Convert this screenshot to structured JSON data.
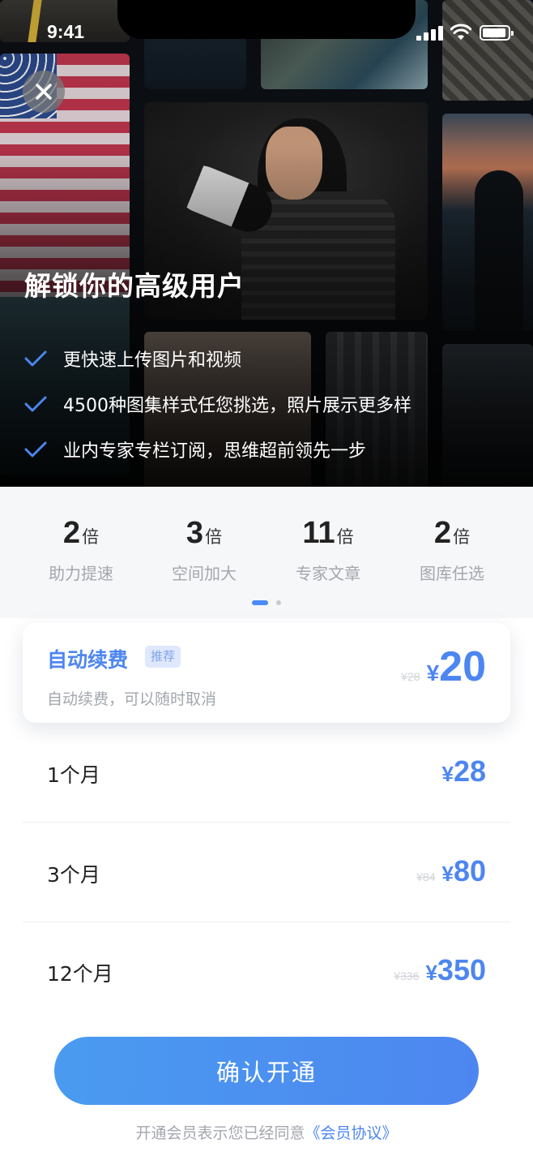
{
  "status_bar": {
    "time": "9:41"
  },
  "hero": {
    "title": "解锁你的高级用户",
    "benefits": [
      "更快速上传图片和视频",
      "4500种图集样式任您挑选，照片展示更多样",
      "业内专家专栏订阅，思维超前领先一步"
    ]
  },
  "stats": [
    {
      "value": "2",
      "unit": "倍",
      "label": "助力提速"
    },
    {
      "value": "3",
      "unit": "倍",
      "label": "空间加大"
    },
    {
      "value": "11",
      "unit": "倍",
      "label": "专家文章"
    },
    {
      "value": "2",
      "unit": "倍",
      "label": "图库任选"
    }
  ],
  "pager": {
    "pages": 2,
    "current": 1
  },
  "plans": {
    "featured": {
      "name": "自动续费",
      "badge": "推荐",
      "subtitle": "自动续费，可以随时取消",
      "original_price": "¥28",
      "currency": "¥",
      "price": "20"
    },
    "options": [
      {
        "name": "1个月",
        "original_price": "",
        "currency": "¥",
        "price": "28"
      },
      {
        "name": "3个月",
        "original_price": "¥84",
        "currency": "¥",
        "price": "80"
      },
      {
        "name": "12个月",
        "original_price": "¥336",
        "currency": "¥",
        "price": "350"
      }
    ]
  },
  "footer": {
    "confirm_label": "确认开通",
    "agreement_text": "开通会员表示您已经同意",
    "agreement_link": "《会员协议》"
  },
  "colors": {
    "accent": "#4d86f0",
    "muted": "#a3a7ad",
    "badge_bg": "#dfe8fc"
  }
}
